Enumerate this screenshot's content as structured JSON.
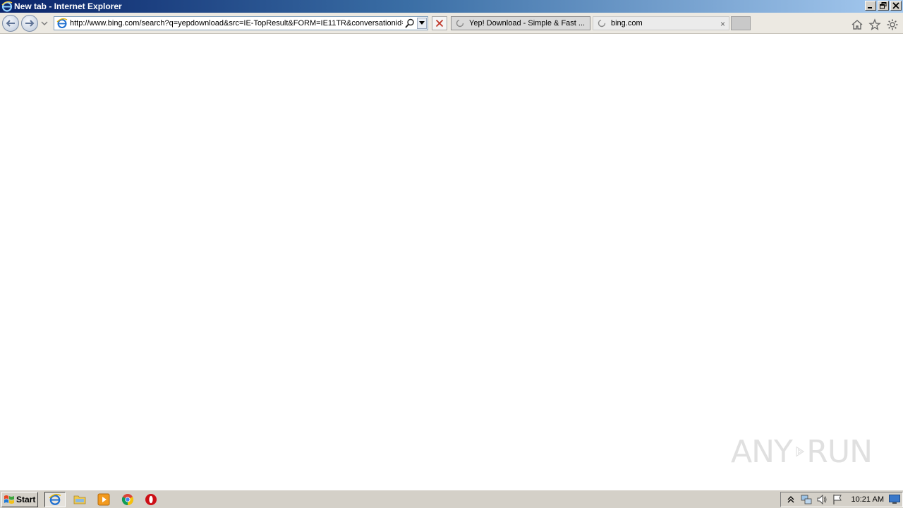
{
  "window": {
    "title": "New tab - Internet Explorer"
  },
  "address_bar": {
    "url": "http://www.bing.com/search?q=yepdownload&src=IE-TopResult&FORM=IE11TR&conversationid="
  },
  "tabs": [
    {
      "label": "Yep! Download - Simple & Fast ...",
      "active": false
    },
    {
      "label": "bing.com",
      "active": true,
      "close_label": "×"
    }
  ],
  "icons": {
    "home": "home-icon",
    "favorites": "star-icon",
    "tools": "gear-icon"
  },
  "watermark": {
    "text_left": "ANY",
    "text_right": "RUN"
  },
  "taskbar": {
    "start_label": "Start",
    "clock": "10:21 AM"
  },
  "colors": {
    "titlebar_start": "#0a246a",
    "titlebar_end": "#a6caf0",
    "taskbar": "#d4d0c8",
    "opera_red": "#cc0f16"
  }
}
